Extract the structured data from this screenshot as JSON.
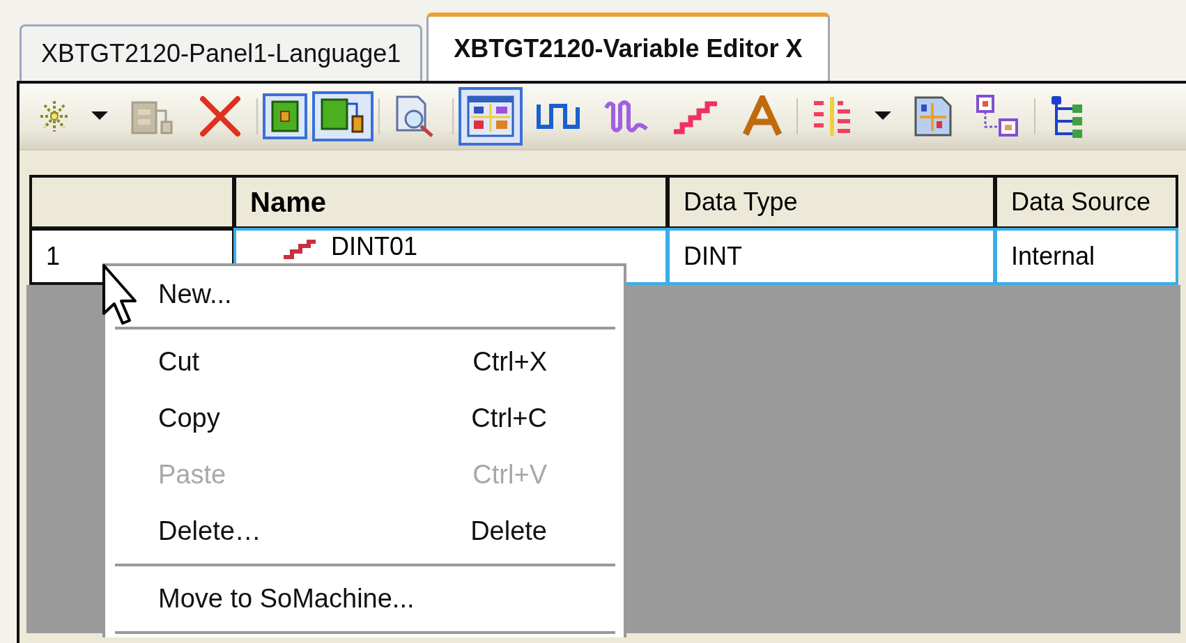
{
  "tabs": [
    {
      "label": "XBTGT2120-Panel1-Language1",
      "selected": false
    },
    {
      "label": "XBTGT2120-Variable Editor X",
      "selected": true
    }
  ],
  "toolbar": [
    {
      "kind": "spark",
      "pressed": false
    },
    {
      "kind": "dropdown",
      "pressed": false
    },
    {
      "kind": "device",
      "pressed": false
    },
    {
      "kind": "delete",
      "pressed": false
    },
    {
      "kind": "sep"
    },
    {
      "kind": "green",
      "pressed": true
    },
    {
      "kind": "green-link",
      "pressed": true
    },
    {
      "kind": "sep"
    },
    {
      "kind": "doc-search",
      "pressed": false
    },
    {
      "kind": "sep"
    },
    {
      "kind": "grid",
      "pressed": true
    },
    {
      "kind": "square-wave",
      "pressed": false
    },
    {
      "kind": "wave",
      "pressed": false
    },
    {
      "kind": "steps",
      "pressed": false
    },
    {
      "kind": "letter",
      "pressed": false
    },
    {
      "kind": "sep"
    },
    {
      "kind": "list",
      "pressed": false
    },
    {
      "kind": "dropdown",
      "pressed": false
    },
    {
      "kind": "doc-grid",
      "pressed": false
    },
    {
      "kind": "link-boxes",
      "pressed": false
    },
    {
      "kind": "sep"
    },
    {
      "kind": "tree",
      "pressed": false
    }
  ],
  "table": {
    "columns": [
      {
        "label": "Name",
        "sorted": true
      },
      {
        "label": "Data Type",
        "sorted": false
      },
      {
        "label": "Data Source",
        "sorted": false
      }
    ],
    "rows": [
      {
        "number": "1",
        "name": "DINT01",
        "data_type": "DINT",
        "data_source": "Internal",
        "selected": true
      }
    ]
  },
  "context_menu": [
    {
      "kind": "item",
      "label": "New...",
      "disabled": false
    },
    {
      "kind": "separator"
    },
    {
      "kind": "item",
      "label": "Cut",
      "shortcut": "Ctrl+X",
      "disabled": false
    },
    {
      "kind": "item",
      "label": "Copy",
      "shortcut": "Ctrl+C",
      "disabled": false
    },
    {
      "kind": "item",
      "label": "Paste",
      "shortcut": "Ctrl+V",
      "disabled": true
    },
    {
      "kind": "item",
      "label": "Delete…",
      "shortcut": "Delete",
      "disabled": false
    },
    {
      "kind": "separator"
    },
    {
      "kind": "item",
      "label": "Move to SoMachine...",
      "disabled": false
    },
    {
      "kind": "separator"
    }
  ]
}
